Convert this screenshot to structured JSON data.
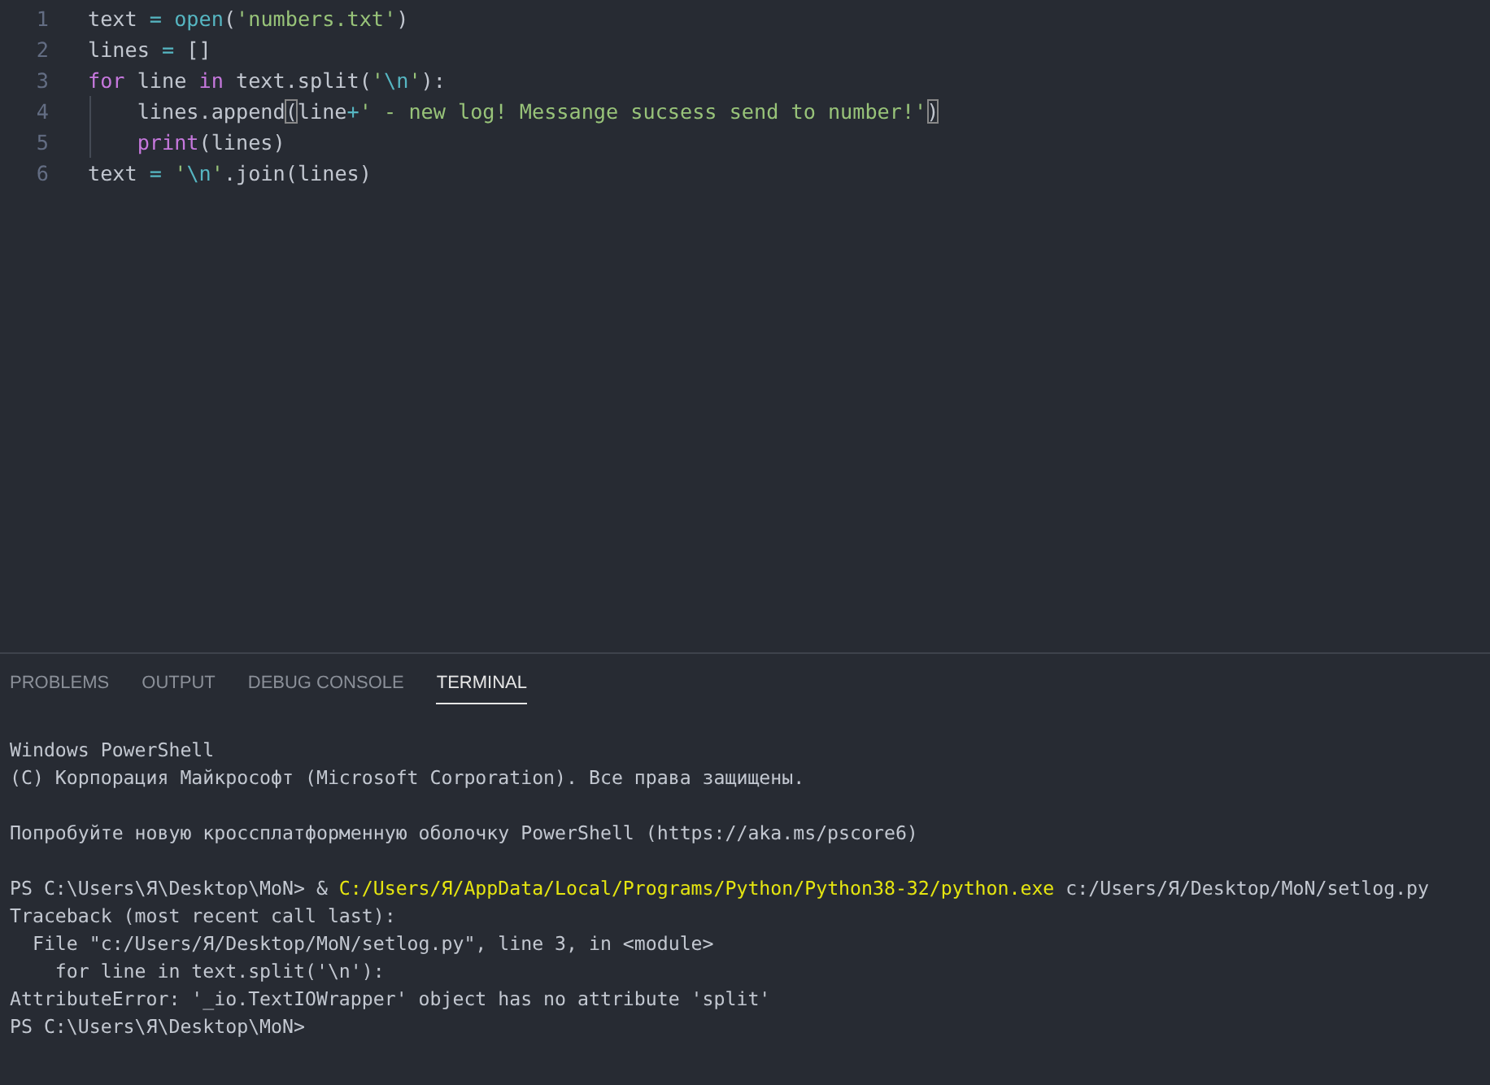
{
  "editor": {
    "lines": [
      {
        "number": "1",
        "indent_guide": false,
        "tokens": [
          {
            "kind": "plain",
            "text": "text "
          },
          {
            "kind": "operator",
            "text": "= "
          },
          {
            "kind": "func",
            "text": "open"
          },
          {
            "kind": "plain",
            "text": "("
          },
          {
            "kind": "string",
            "text": "'numbers.txt'"
          },
          {
            "kind": "plain",
            "text": ")"
          }
        ]
      },
      {
        "number": "2",
        "indent_guide": false,
        "tokens": [
          {
            "kind": "plain",
            "text": "lines "
          },
          {
            "kind": "operator",
            "text": "="
          },
          {
            "kind": "plain",
            "text": " []"
          }
        ]
      },
      {
        "number": "3",
        "indent_guide": false,
        "tokens": [
          {
            "kind": "keyword",
            "text": "for"
          },
          {
            "kind": "plain",
            "text": " line "
          },
          {
            "kind": "keyword",
            "text": "in"
          },
          {
            "kind": "plain",
            "text": " text.split("
          },
          {
            "kind": "string",
            "text": "'"
          },
          {
            "kind": "escape",
            "text": "\\n"
          },
          {
            "kind": "string",
            "text": "'"
          },
          {
            "kind": "plain",
            "text": "):"
          }
        ]
      },
      {
        "number": "4",
        "indent_guide": true,
        "tokens": [
          {
            "kind": "plain",
            "text": "    lines.append"
          },
          {
            "kind": "bracket-match",
            "text": "("
          },
          {
            "kind": "plain",
            "text": "line"
          },
          {
            "kind": "operator",
            "text": "+"
          },
          {
            "kind": "string",
            "text": "' - new log! Messange sucsess send to number!'"
          },
          {
            "kind": "bracket-match",
            "text": ")"
          }
        ]
      },
      {
        "number": "5",
        "indent_guide": true,
        "tokens": [
          {
            "kind": "builtin",
            "text": "    print"
          },
          {
            "kind": "plain",
            "text": "(lines)"
          }
        ]
      },
      {
        "number": "6",
        "indent_guide": false,
        "tokens": [
          {
            "kind": "plain",
            "text": "text "
          },
          {
            "kind": "operator",
            "text": "= "
          },
          {
            "kind": "string",
            "text": "'"
          },
          {
            "kind": "escape",
            "text": "\\n"
          },
          {
            "kind": "string",
            "text": "'"
          },
          {
            "kind": "plain",
            "text": ".join(lines)"
          }
        ]
      }
    ]
  },
  "panel": {
    "tabs": [
      {
        "label": "PROBLEMS",
        "selected": false
      },
      {
        "label": "OUTPUT",
        "selected": false
      },
      {
        "label": "DEBUG CONSOLE",
        "selected": false
      },
      {
        "label": "TERMINAL",
        "selected": true
      }
    ],
    "terminal": {
      "blocks": [
        [
          {
            "segments": [
              {
                "kind": "plain",
                "text": "Windows PowerShell"
              }
            ]
          },
          {
            "segments": [
              {
                "kind": "plain",
                "text": "(C) Корпорация Майкрософт (Microsoft Corporation). Все права защищены."
              }
            ]
          }
        ],
        [
          {
            "segments": [
              {
                "kind": "plain",
                "text": "Попробуйте новую кроссплатформенную оболочку PowerShell (https://aka.ms/pscore6)"
              }
            ]
          }
        ],
        [
          {
            "segments": [
              {
                "kind": "plain",
                "text": "PS C:\\Users\\Я\\Desktop\\MoN> & "
              },
              {
                "kind": "path",
                "text": "C:/Users/Я/AppData/Local/Programs/Python/Python38-32/python.exe"
              },
              {
                "kind": "plain",
                "text": " c:/Users/Я/Desktop/MoN/setlog.py"
              }
            ]
          },
          {
            "segments": [
              {
                "kind": "plain",
                "text": "Traceback (most recent call last):"
              }
            ]
          },
          {
            "segments": [
              {
                "kind": "plain",
                "text": "  File \"c:/Users/Я/Desktop/MoN/setlog.py\", line 3, in <module>"
              }
            ]
          },
          {
            "segments": [
              {
                "kind": "plain",
                "text": "    for line in text.split('\\n'):"
              }
            ]
          },
          {
            "segments": [
              {
                "kind": "plain",
                "text": "AttributeError: '_io.TextIOWrapper' object has no attribute 'split'"
              }
            ]
          },
          {
            "segments": [
              {
                "kind": "plain",
                "text": "PS C:\\Users\\Я\\Desktop\\MoN>"
              }
            ]
          }
        ]
      ]
    }
  }
}
